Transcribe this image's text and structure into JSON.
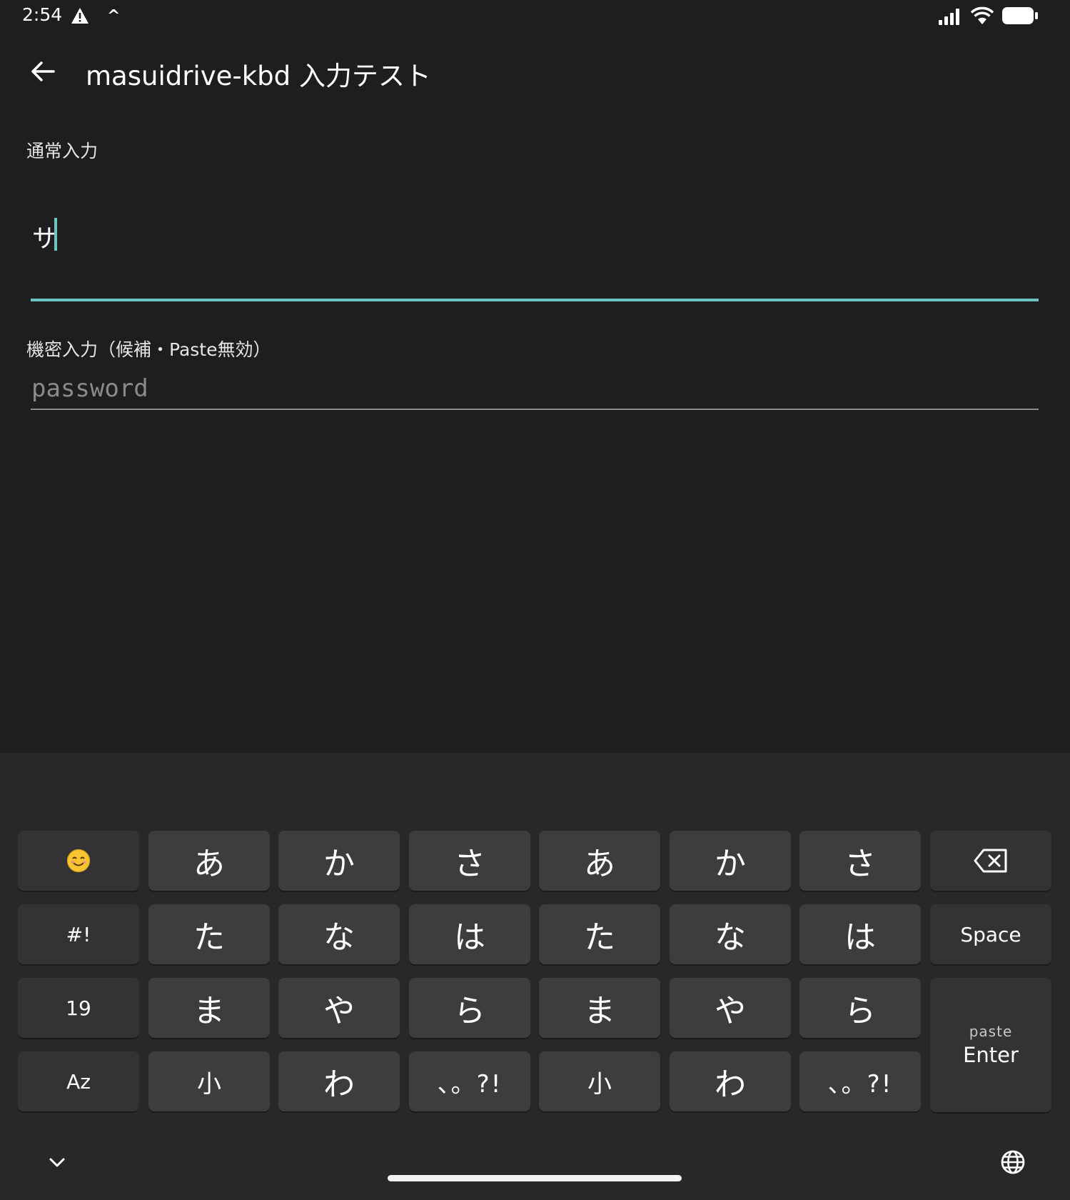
{
  "status_bar": {
    "time": "2:54",
    "icons": [
      "warning-icon",
      "caret-up-icon",
      "signal-icon",
      "wifi-icon",
      "battery-icon"
    ]
  },
  "app_bar": {
    "title": "masuidrive-kbd 入力テスト",
    "back_icon": "arrow-back-icon"
  },
  "fields": {
    "normal": {
      "label": "通常入力",
      "value": "サ"
    },
    "secret": {
      "label": "機密入力（候補・Paste無効）",
      "placeholder": "password"
    }
  },
  "keyboard": {
    "row1": {
      "emoji": "☺",
      "k1": "あ",
      "k2": "か",
      "k3": "さ",
      "k4": "あ",
      "k5": "か",
      "k6": "さ",
      "backspace_icon": "backspace-icon"
    },
    "row2": {
      "symbol": "#!",
      "k1": "た",
      "k2": "な",
      "k3": "は",
      "k4": "た",
      "k5": "な",
      "k6": "は",
      "space": "Space"
    },
    "row3": {
      "number": "19",
      "k1": "ま",
      "k2": "や",
      "k3": "ら",
      "k4": "ま",
      "k5": "や",
      "k6": "ら",
      "enter_sub": "paste",
      "enter": "Enter"
    },
    "row4": {
      "alpha": "Az",
      "k1": "小",
      "k2": "わ",
      "k3": "、。?!",
      "k4": "小",
      "k5": "わ",
      "k6": "、。?!"
    },
    "bottom_icons": [
      "chevron-down-icon",
      "globe-icon"
    ]
  },
  "colors": {
    "background": "#1e1e20",
    "keyboard_background": "#28282a",
    "key": "#3d3d40",
    "accent": "#6ec4c0"
  }
}
